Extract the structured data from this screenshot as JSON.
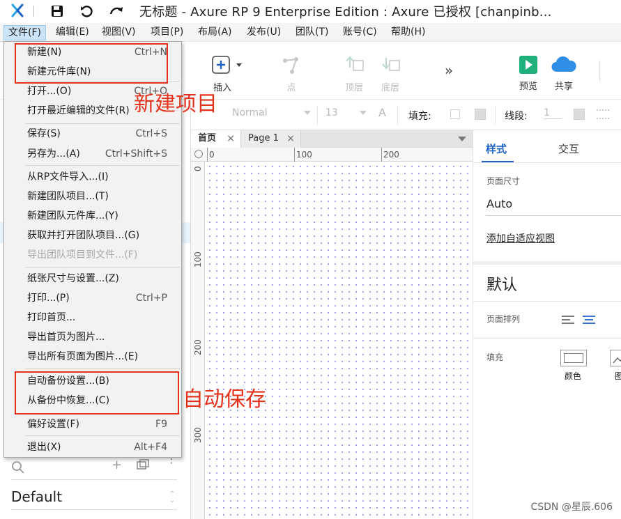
{
  "titlebar": {
    "title": "无标题 - Axure RP 9 Enterprise Edition : Axure 已授权    [chanpinb..."
  },
  "menubar": [
    {
      "label": "文件(F)",
      "active": true
    },
    {
      "label": "编辑(E)"
    },
    {
      "label": "视图(V)"
    },
    {
      "label": "项目(P)"
    },
    {
      "label": "布局(A)"
    },
    {
      "label": "发布(U)"
    },
    {
      "label": "团队(T)"
    },
    {
      "label": "账号(C)"
    },
    {
      "label": "帮助(H)"
    }
  ],
  "toolbar": {
    "insert": "插入",
    "point": "点",
    "top": "顶层",
    "bottom": "底层",
    "preview": "预览",
    "share": "共享"
  },
  "formatbar": {
    "style": "Normal",
    "font_size": "13",
    "fill": "填充:",
    "stroke": "线段:",
    "stroke_value": "1"
  },
  "tabs": [
    {
      "label": "首页",
      "active": true
    },
    {
      "label": "Page 1"
    }
  ],
  "ruler": {
    "h": [
      "0",
      "100",
      "200"
    ],
    "v": [
      "0",
      "100",
      "200",
      "300"
    ]
  },
  "right_panel": {
    "tab_style": "样式",
    "tab_interact": "交互",
    "page_size_label": "页面尺寸",
    "page_size_value": "Auto",
    "add_adaptive": "添加自适应视图",
    "default_title": "默认",
    "page_align_label": "页面排列",
    "fill_label": "填充",
    "color_label": "颜色",
    "image_label": "图"
  },
  "left_panel": {
    "default_label": "Default"
  },
  "file_menu": {
    "items": [
      {
        "label": "新建(N)",
        "shortcut": "Ctrl+N"
      },
      {
        "label": "新建元件库(N)",
        "shortcut": ""
      },
      {
        "label": "打开...(O)",
        "shortcut": "Ctrl+O"
      },
      {
        "label": "打开最近编辑的文件(R)",
        "shortcut": ""
      },
      {
        "label": "保存(S)",
        "shortcut": "Ctrl+S"
      },
      {
        "label": "另存为...(A)",
        "shortcut": "Ctrl+Shift+S"
      },
      {
        "label": "从RP文件导入...(I)",
        "shortcut": ""
      },
      {
        "label": "新建团队项目...(T)",
        "shortcut": ""
      },
      {
        "label": "新建团队元件库...(Y)",
        "shortcut": ""
      },
      {
        "label": "获取并打开团队项目...(G)",
        "shortcut": ""
      },
      {
        "label": "导出团队项目到文件...(F)",
        "shortcut": "",
        "disabled": true
      },
      {
        "label": "纸张尺寸与设置...(Z)",
        "shortcut": ""
      },
      {
        "label": "打印...(P)",
        "shortcut": "Ctrl+P"
      },
      {
        "label": "打印首页...",
        "shortcut": ""
      },
      {
        "label": "导出首页为图片...",
        "shortcut": ""
      },
      {
        "label": "导出所有页面为图片...(E)",
        "shortcut": ""
      },
      {
        "label": "自动备份设置...(B)",
        "shortcut": ""
      },
      {
        "label": "从备份中恢复...(C)",
        "shortcut": ""
      },
      {
        "label": "偏好设置(F)",
        "shortcut": "F9"
      },
      {
        "label": "退出(X)",
        "shortcut": "Alt+F4"
      }
    ]
  },
  "annotations": {
    "new_project": "新建项目",
    "auto_save": "自动保存"
  },
  "watermark": "CSDN @星辰.606",
  "colors": {
    "accent_blue": "#1d63c7",
    "annotation_red": "#e5321c",
    "preview_green": "#20b17a",
    "share_blue": "#2f8ee6"
  }
}
